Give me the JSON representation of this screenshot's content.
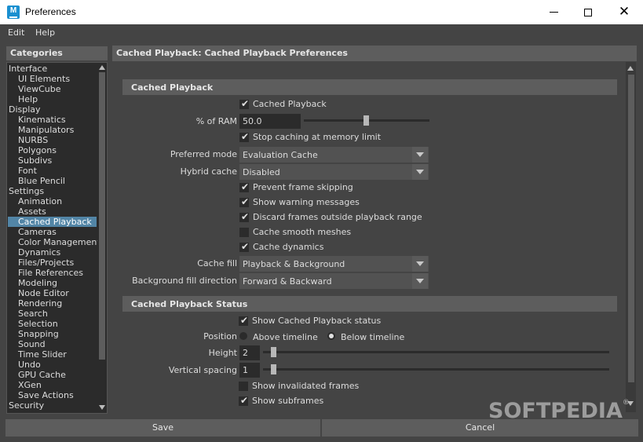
{
  "window": {
    "title": "Preferences",
    "icon_letter": "M"
  },
  "menu": {
    "edit": "Edit",
    "help": "Help"
  },
  "categories": {
    "header": "Categories",
    "items": [
      {
        "label": "Interface",
        "level": 0
      },
      {
        "label": "UI Elements",
        "level": 1
      },
      {
        "label": "ViewCube",
        "level": 1
      },
      {
        "label": "Help",
        "level": 1
      },
      {
        "label": "Display",
        "level": 0
      },
      {
        "label": "Kinematics",
        "level": 1
      },
      {
        "label": "Manipulators",
        "level": 1
      },
      {
        "label": "NURBS",
        "level": 1
      },
      {
        "label": "Polygons",
        "level": 1
      },
      {
        "label": "Subdivs",
        "level": 1
      },
      {
        "label": "Font",
        "level": 1
      },
      {
        "label": "Blue Pencil",
        "level": 1
      },
      {
        "label": "Settings",
        "level": 0
      },
      {
        "label": "Animation",
        "level": 1
      },
      {
        "label": "Assets",
        "level": 1
      },
      {
        "label": "Cached Playback",
        "level": 1,
        "selected": true
      },
      {
        "label": "Cameras",
        "level": 1
      },
      {
        "label": "Color Management",
        "level": 1
      },
      {
        "label": "Dynamics",
        "level": 1
      },
      {
        "label": "Files/Projects",
        "level": 1
      },
      {
        "label": "File References",
        "level": 1
      },
      {
        "label": "Modeling",
        "level": 1
      },
      {
        "label": "Node Editor",
        "level": 1
      },
      {
        "label": "Rendering",
        "level": 1
      },
      {
        "label": "Search",
        "level": 1
      },
      {
        "label": "Selection",
        "level": 1
      },
      {
        "label": "Snapping",
        "level": 1
      },
      {
        "label": "Sound",
        "level": 1
      },
      {
        "label": "Time Slider",
        "level": 1
      },
      {
        "label": "Undo",
        "level": 1
      },
      {
        "label": "GPU Cache",
        "level": 1
      },
      {
        "label": "XGen",
        "level": 1
      },
      {
        "label": "Save Actions",
        "level": 1
      },
      {
        "label": "Security",
        "level": 0
      }
    ]
  },
  "pane": {
    "header": "Cached Playback: Cached Playback Preferences",
    "cached_playback": {
      "section_title": "Cached Playback",
      "enable": {
        "label": "Cached Playback",
        "checked": true
      },
      "ram": {
        "label": "% of RAM",
        "value": "50.0",
        "slider_fraction": 0.5
      },
      "stop_caching": {
        "label": "Stop caching at memory limit",
        "checked": true
      },
      "preferred_mode": {
        "label": "Preferred mode",
        "value": "Evaluation Cache"
      },
      "hybrid_cache": {
        "label": "Hybrid cache",
        "value": "Disabled"
      },
      "prevent_skipping": {
        "label": "Prevent frame skipping",
        "checked": true
      },
      "show_warning": {
        "label": "Show warning messages",
        "checked": true
      },
      "discard_frames": {
        "label": "Discard frames outside playback range",
        "checked": true
      },
      "smooth_meshes": {
        "label": "Cache smooth meshes",
        "checked": false
      },
      "cache_dynamics": {
        "label": "Cache dynamics",
        "checked": true
      },
      "cache_fill": {
        "label": "Cache fill",
        "value": "Playback & Background"
      },
      "bg_fill_direction": {
        "label": "Background fill direction",
        "value": "Forward & Backward"
      }
    },
    "status": {
      "section_title": "Cached Playback Status",
      "show_status": {
        "label": "Show Cached Playback status",
        "checked": true
      },
      "position": {
        "label": "Position",
        "option_above": "Above timeline",
        "option_below": "Below timeline",
        "selected": "Below timeline"
      },
      "height": {
        "label": "Height",
        "value": "2",
        "slider_fraction": 0.02
      },
      "vertical_spacing": {
        "label": "Vertical spacing",
        "value": "1",
        "slider_fraction": 0.02
      },
      "show_invalidated": {
        "label": "Show invalidated frames",
        "checked": false
      },
      "show_subframes": {
        "label": "Show subframes",
        "checked": true
      }
    }
  },
  "buttons": {
    "save": "Save",
    "cancel": "Cancel"
  },
  "watermark": {
    "text": "SOFTPEDIA",
    "mark": "®"
  }
}
